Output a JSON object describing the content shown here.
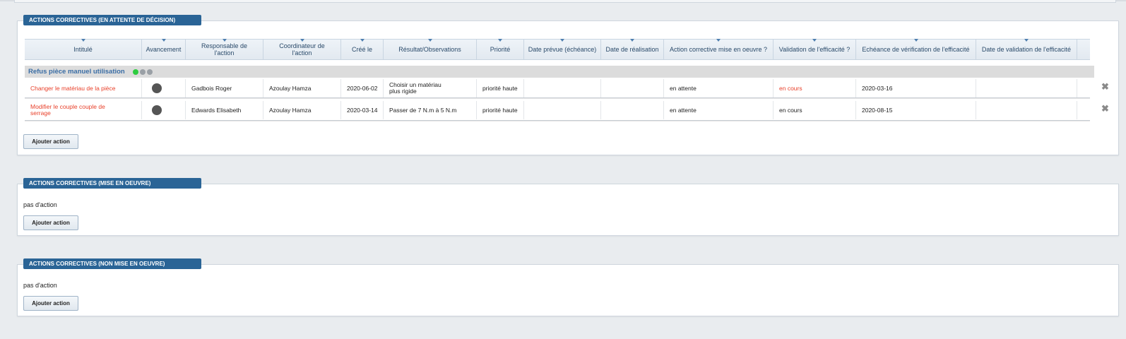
{
  "panels": {
    "pending": {
      "title": "ACTIONS CORRECTIVES (EN ATTENTE DE DÉCISION)",
      "columns": [
        "Intitulé",
        "Avancement",
        "Responsable de l'action",
        "Coordinateur de l'action",
        "Créé le",
        "Résultat/Observations",
        "Priorité",
        "Date prévue (échéance)",
        "Date de réalisation",
        "Action corrective mise en oeuvre ?",
        "Validation de l'efficacité ?",
        "Echéance de vérification de l'efficacité",
        "Date de validation de l'efficacité"
      ],
      "group": {
        "label": "Refus pièce manuel utilisation",
        "status_colors": [
          "#2ecc40",
          "#9aa0a6",
          "#9aa0a6"
        ]
      },
      "rows": [
        {
          "title": "Changer le matériau de la pièce",
          "progress_color": "#555555",
          "responsable": "Gadbois Roger",
          "coordinateur": "Azoulay Hamza",
          "cree_le": "2020-06-02",
          "resultat": "Choisir un matériau plus rigide",
          "priorite": "priorité haute",
          "date_prevue": "",
          "date_realisation": "",
          "mise_en_oeuvre": "en attente",
          "validation": "en cours",
          "echeance_verif": "2020-03-16",
          "date_validation": ""
        },
        {
          "title": "Modifier le couple couple de serrage",
          "progress_color": "#555555",
          "responsable": "Edwards Elisabeth",
          "coordinateur": "Azoulay Hamza",
          "cree_le": "2020-03-14",
          "resultat": "Passer de 7 N.m à 5 N.m",
          "priorite": "priorité haute",
          "date_prevue": "",
          "date_realisation": "",
          "mise_en_oeuvre": "en attente",
          "validation": "en cours",
          "echeance_verif": "2020-08-15",
          "date_validation": ""
        }
      ],
      "remove_icon": "✖",
      "add_button": "Ajouter action"
    },
    "implemented": {
      "title": "ACTIONS CORRECTIVES (MISE EN OEUVRE)",
      "empty_text": "pas d'action",
      "add_button": "Ajouter action"
    },
    "not_implemented": {
      "title": "ACTIONS CORRECTIVES (NON MISE EN OEUVRE)",
      "empty_text": "pas d'action",
      "add_button": "Ajouter action"
    }
  },
  "colors": {
    "header_blue": "#2a6496",
    "link_red": "#e8402a",
    "group_label_blue": "#3b6ea5"
  }
}
